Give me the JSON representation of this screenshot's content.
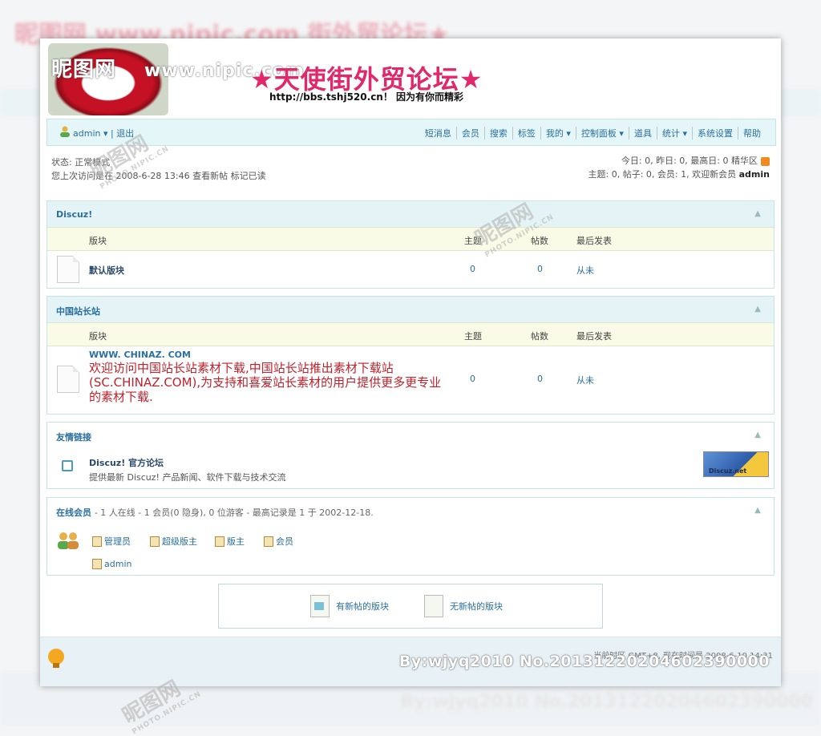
{
  "background": {
    "title": "昵图网 www.nipic.com 街外贸论坛★",
    "footer_mark": "By:wjyq2010 No.20131220204602390000"
  },
  "banner": {
    "logo_text": "昵图网",
    "logo_url": "www.nipic.com",
    "forum_title": "★天使街外贸论坛★",
    "forum_subtitle": "http://bbs.tshj520.cn！ 因为有你而精彩"
  },
  "navbar": {
    "user": "admin",
    "logout": "退出",
    "menu": [
      "短消息",
      "会员",
      "搜索",
      "标签",
      "我的 ▾",
      "控制面板 ▾",
      "道具",
      "统计 ▾",
      "系统设置",
      "帮助"
    ]
  },
  "status": {
    "mode": "状态: 正常模式",
    "last_visit": "您上次访问是在 2008-6-28 13:46 查看新帖 标记已读"
  },
  "stats": {
    "line1": "今日: 0, 昨日: 0, 最高日: 0   精华区",
    "line2_prefix": "主题: 0, 帖子: 0, 会员: 1, 欢迎新会员",
    "newest_member": "admin"
  },
  "categories": [
    {
      "title": "Discuz!",
      "columns": {
        "forum": "版块",
        "threads": "主题",
        "posts": "帖数",
        "last": "最后发表"
      },
      "forum_name": "默认版块",
      "threads": "0",
      "posts": "0",
      "last": "从未"
    },
    {
      "title": "中国站长站",
      "columns": {
        "forum": "版块",
        "threads": "主题",
        "posts": "帖数",
        "last": "最后发表"
      },
      "ad_url": "WWW. CHINAZ. COM",
      "ad_text": "欢迎访问中国站长站素材下载,中国站长站推出素材下载站(SC.CHINAZ.COM),为支持和喜爱站长素材的用户提供更多更专业的素材下载.",
      "threads": "0",
      "posts": "0",
      "last": "从未"
    }
  ],
  "links": {
    "title": "友情链接",
    "name": "Discuz! 官方论坛",
    "desc": "提供最新 Discuz! 产品新闻、软件下载与技术交流",
    "banner_text": "Discuz.net"
  },
  "online": {
    "title": "在线会员",
    "summary": "- 1 人在线 - 1 会员(0 隐身), 0 位游客 - 最高记录是 1 于 2002-12-18.",
    "groups": [
      "管理员",
      "超级版主",
      "版主",
      "会员"
    ],
    "users": [
      "admin"
    ]
  },
  "legend": {
    "new": "有新帖的版块",
    "none": "无新帖的版块"
  },
  "footer": {
    "time": "当前时区 GMT+8, 现在时间是 2008-6-10 14:31",
    "watermark": "By:wjyq2010 No.20131220204602390000"
  },
  "stamps": [
    "昵图网",
    "PHOTO.NIPIC.CN"
  ]
}
